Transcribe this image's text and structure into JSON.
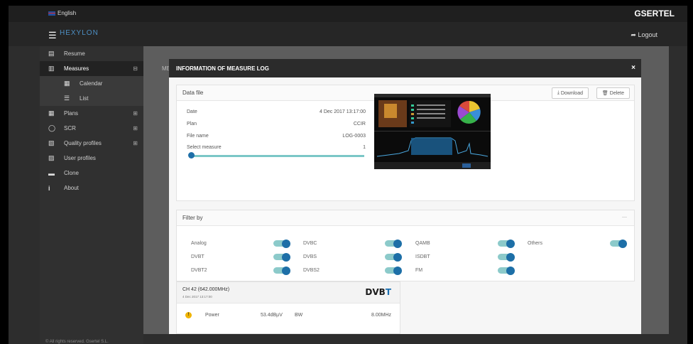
{
  "topbar": {
    "language": "English",
    "brand": "GSERTEL"
  },
  "header": {
    "logo": "HEXYLON",
    "logout": "Logout"
  },
  "sidebar": {
    "items": [
      {
        "label": "Resume",
        "icon": "book-icon"
      },
      {
        "label": "Measures",
        "icon": "chart-icon",
        "expander": "⊟"
      },
      {
        "label": "Calendar",
        "icon": "calendar-icon"
      },
      {
        "label": "List",
        "icon": "list-icon"
      },
      {
        "label": "Plans",
        "icon": "grid-icon",
        "expander": "⊞"
      },
      {
        "label": "SCR",
        "icon": "circle-icon",
        "expander": "⊞"
      },
      {
        "label": "Quality profiles",
        "icon": "profile-icon",
        "expander": "⊞"
      },
      {
        "label": "User profiles",
        "icon": "users-icon"
      },
      {
        "label": "Clone",
        "icon": "clone-icon"
      },
      {
        "label": "About",
        "icon": "info-icon"
      }
    ]
  },
  "background": {
    "page_label": "MEA"
  },
  "modal": {
    "title": "INFORMATION OF MEASURE LOG",
    "close": "×",
    "data_file": {
      "heading": "Data file",
      "download": "Download",
      "delete": "Delete",
      "date_label": "Date",
      "date_value": "4 Dec 2017 13:17:00",
      "plan_label": "Plan",
      "plan_value": "CCIR",
      "file_label": "File name",
      "file_value": "LOG-0003",
      "measure_label": "Select measure",
      "measure_value": "1"
    },
    "filter": {
      "heading": "Filter by",
      "collapse": "—",
      "toggles": [
        {
          "label": "Analog",
          "on": true
        },
        {
          "label": "DVBC",
          "on": true
        },
        {
          "label": "QAMB",
          "on": true
        },
        {
          "label": "Others",
          "on": true
        },
        {
          "label": "DVBT",
          "on": true
        },
        {
          "label": "DVBS",
          "on": true
        },
        {
          "label": "ISDBT",
          "on": true
        },
        {
          "label": "DVBT2",
          "on": true
        },
        {
          "label": "DVBS2",
          "on": true
        },
        {
          "label": "FM",
          "on": true
        }
      ]
    },
    "channel": {
      "title": "CH 42 (642.000MHz)",
      "date": "4 Dec 2017 13:17:00",
      "standard_a": "DV",
      "standard_b": "B",
      "standard_c": "T",
      "power_label": "Power",
      "power_value": "53.4dBµV",
      "bw_label": "BW",
      "bw_value": "8.00MHz"
    }
  },
  "footer": {
    "text": "© All rights reserved. Gsertel S.L."
  },
  "colors": {
    "toggle_on": "#1d6fa7",
    "track": "#8ccaca",
    "sidebar": "#303030",
    "header": "#262626"
  }
}
